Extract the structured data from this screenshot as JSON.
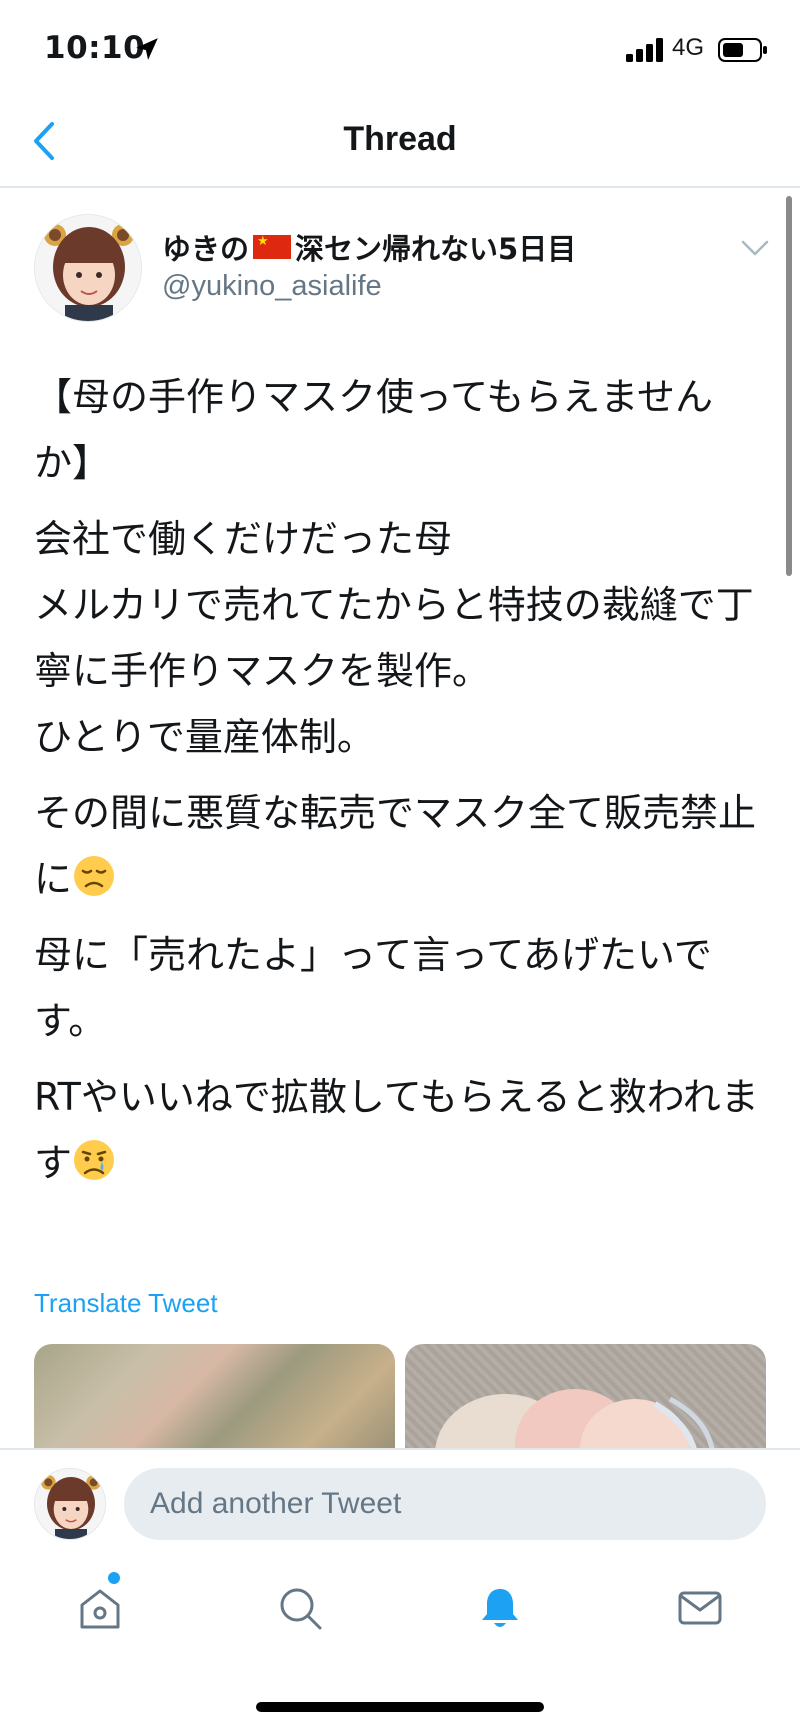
{
  "status_bar": {
    "time": "10:10",
    "network": "4G",
    "location_icon": "location-arrow-icon",
    "signal_icon": "signal-bars-icon",
    "battery_icon": "battery-icon"
  },
  "nav": {
    "title": "Thread",
    "back_icon": "chevron-left-icon"
  },
  "tweet": {
    "user_name_before_flag": "ゆきの",
    "user_name_after_flag": "深セン帰れない5日目",
    "handle": "@yukino_asialife",
    "paragraphs": [
      "【母の手作りマスク使ってもらえませんか】",
      "会社で働くだけだった母\nメルカリで売れてたからと特技の裁縫で丁寧に手作りマスクを製作。\nひとりで量産体制。",
      "その間に悪質な転売でマスク全て販売禁止に",
      "母に「売れたよ」って言ってあげたいです。",
      "RTやいいねで拡散してもらえると救われます"
    ],
    "translate_label": "Translate Tweet"
  },
  "reply": {
    "placeholder": "Add another Tweet"
  },
  "tabs": [
    {
      "icon": "home-icon",
      "active": false,
      "badge": true
    },
    {
      "icon": "search-icon",
      "active": false
    },
    {
      "icon": "bell-icon",
      "active": true
    },
    {
      "icon": "mail-icon",
      "active": false
    }
  ],
  "colors": {
    "accent": "#1da1f2",
    "secondary_text": "#657786",
    "divider": "#e1e8ed",
    "input_bg": "#e6ecf0"
  }
}
